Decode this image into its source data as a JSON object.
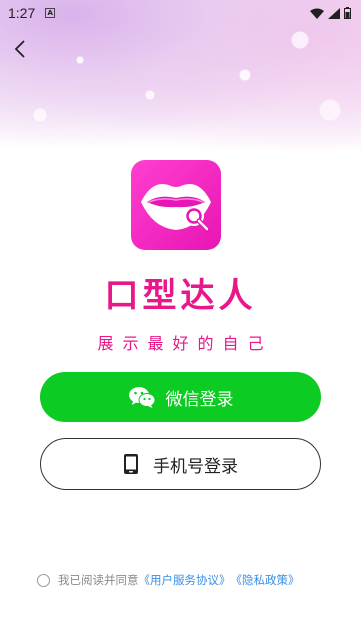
{
  "status_bar": {
    "time": "1:27",
    "notification_badge": "A"
  },
  "header": {
    "back_icon": "chevron-left-icon"
  },
  "app": {
    "name": "口型达人",
    "slogan": "展示最好的自己",
    "icon_gradient": [
      "#ff3fd0",
      "#e815b4"
    ]
  },
  "buttons": {
    "wechat_label": "微信登录",
    "phone_label": "手机号登录"
  },
  "agreement": {
    "prefix": "我已阅读并同意",
    "user_agreement": "《用户服务协议》",
    "privacy_policy": "《隐私政策》"
  },
  "colors": {
    "brand": "#e8188a",
    "wechat_green": "#0ccb22",
    "link": "#3a8ee6"
  }
}
